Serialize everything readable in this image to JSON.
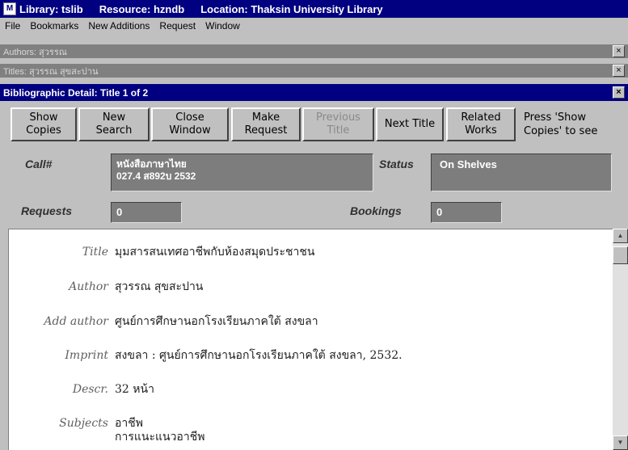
{
  "titlebar": {
    "library": "Library: tslib",
    "resource": "Resource: hzndb",
    "location": "Location: Thaksin University Library"
  },
  "menu": [
    "File",
    "Bookmarks",
    "New Additions",
    "Request",
    "Window"
  ],
  "minimized_windows": {
    "authors": "Authors: สุวรรณ",
    "titles": "Titles: สุวรรณ สุขสะปาน"
  },
  "detail_window": {
    "title": "Bibliographic Detail: Title 1 of 2"
  },
  "toolbar": {
    "show_copies": "Show\nCopies",
    "new_search": "New\nSearch",
    "close_window": "Close\nWindow",
    "make_request": "Make\nRequest",
    "previous_title": "Previous\nTitle",
    "next_title": "Next Title",
    "related_works": "Related\nWorks",
    "hint": "Press 'Show\nCopies' to see"
  },
  "holdings": {
    "call_label": "Call#",
    "call_line1": "หนังสือภาษาไทย",
    "call_line2": "027.4 ส892บ 2532",
    "status_label": "Status",
    "status_value": "On Shelves",
    "requests_label": "Requests",
    "requests_value": "0",
    "bookings_label": "Bookings",
    "bookings_value": "0"
  },
  "record": {
    "title_label": "Title",
    "title_value": "มุมสารสนเทศอาชีพกับห้องสมุดประชาชน",
    "author_label": "Author",
    "author_value": "สุวรรณ สุขสะปาน",
    "add_author_label": "Add author",
    "add_author_value": "ศูนย์การศึกษานอกโรงเรียนภาคใต้ สงขลา",
    "imprint_label": "Imprint",
    "imprint_value": "สงขลา : ศูนย์การศึกษานอกโรงเรียนภาคใต้ สงขลา, 2532.",
    "descr_label": "Descr.",
    "descr_value": "32 หน้า",
    "subjects_label": "Subjects",
    "subjects_value": "อาชีพ\nการแนะแนวอาชีพ"
  },
  "colors": {
    "titlebar": "#000080",
    "panel": "#c0c0c0",
    "field_box": "#7d7d7d"
  }
}
